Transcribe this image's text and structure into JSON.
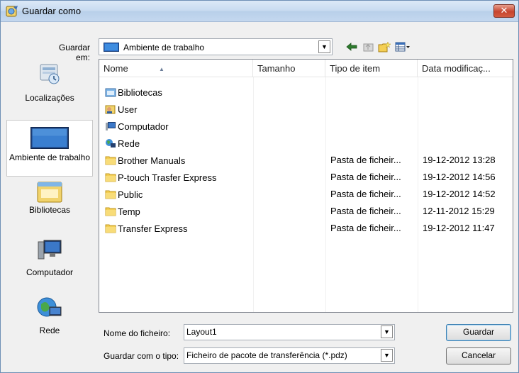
{
  "window": {
    "title": "Guardar como",
    "close_glyph": "✕"
  },
  "save_in": {
    "label": "Guardar em:",
    "value": "Ambiente de trabalho"
  },
  "toolbar": {
    "icons": [
      "back-icon",
      "up-folder-icon",
      "new-folder-icon",
      "view-menu-icon"
    ]
  },
  "places": [
    {
      "label": "Localizações",
      "icon": "recent-locations-icon"
    },
    {
      "label": "Ambiente de trabalho",
      "icon": "desktop-icon",
      "selected": true
    },
    {
      "label": "Bibliotecas",
      "icon": "libraries-icon"
    },
    {
      "label": "Computador",
      "icon": "computer-icon"
    },
    {
      "label": "Rede",
      "icon": "network-icon"
    }
  ],
  "columns": [
    "Nome",
    "Tamanho",
    "Tipo de item",
    "Data modificaç..."
  ],
  "files": [
    {
      "name": "Bibliotecas",
      "icon": "libraries-icon",
      "type": "",
      "date": ""
    },
    {
      "name": "User",
      "icon": "user-icon",
      "type": "",
      "date": ""
    },
    {
      "name": "Computador",
      "icon": "computer-icon",
      "type": "",
      "date": ""
    },
    {
      "name": "Rede",
      "icon": "network-icon",
      "type": "",
      "date": ""
    },
    {
      "name": "Brother Manuals",
      "icon": "folder-icon",
      "type": "Pasta de ficheir...",
      "date": "19-12-2012 13:28"
    },
    {
      "name": "P-touch Trasfer Express",
      "icon": "folder-icon",
      "type": "Pasta de ficheir...",
      "date": "19-12-2012 14:56"
    },
    {
      "name": "Public",
      "icon": "folder-icon",
      "type": "Pasta de ficheir...",
      "date": "19-12-2012 14:52"
    },
    {
      "name": "Temp",
      "icon": "folder-icon",
      "type": "Pasta de ficheir...",
      "date": "12-11-2012 15:29"
    },
    {
      "name": "Transfer Express",
      "icon": "folder-icon",
      "type": "Pasta de ficheir...",
      "date": "19-12-2012 11:47"
    }
  ],
  "file_name": {
    "label": "Nome do ficheiro:",
    "value": "Layout1"
  },
  "file_type": {
    "label": "Guardar com o tipo:",
    "value": "Ficheiro de pacote de transferência (*.pdz)"
  },
  "buttons": {
    "save": "Guardar",
    "cancel": "Cancelar"
  },
  "combo_arrow_glyph": "▼"
}
